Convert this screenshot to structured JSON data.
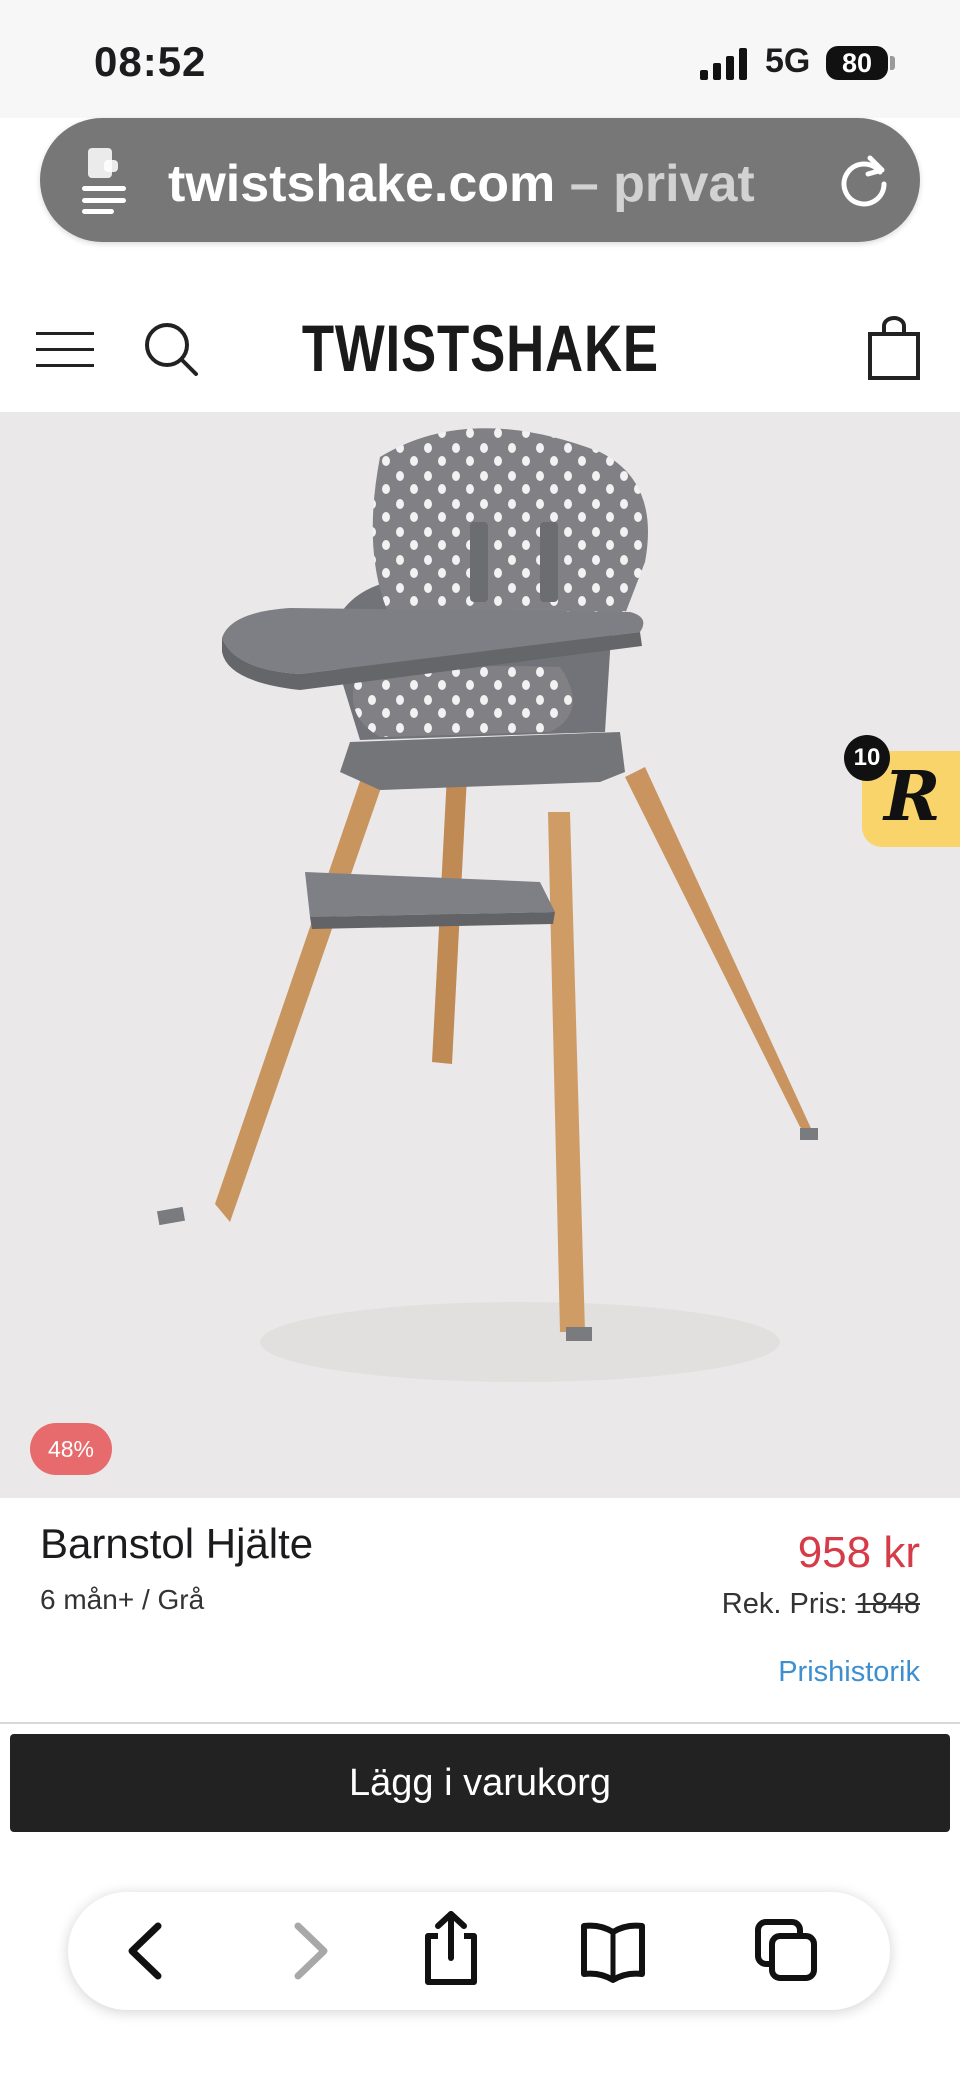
{
  "status_bar": {
    "time": "08:52",
    "network": "5G",
    "battery": "80"
  },
  "browser": {
    "domain": "twistshake.com",
    "mode_suffix": "– privat",
    "url_bar_color": "#777777"
  },
  "header": {
    "logo": "TWISTSHAKE",
    "icons": [
      "menu-icon",
      "search-icon",
      "shopping-bag-icon"
    ]
  },
  "product": {
    "discount_badge": "48%",
    "name": "Barnstol Hjälte",
    "variant": "6 mån+ / Grå",
    "price": "958 kr",
    "rek_label": "Rek. Pris:",
    "old_price": "1848",
    "price_history_link": "Prishistorik",
    "price_color": "#d53c48"
  },
  "reviews_widget": {
    "count": "10",
    "letter": "R",
    "color": "#f8d46a"
  },
  "cta": {
    "add_to_cart": "Lägg i varukorg"
  },
  "toolbar": {
    "icons": [
      "back-icon",
      "forward-icon",
      "share-icon",
      "bookmarks-icon",
      "tabs-icon"
    ]
  }
}
